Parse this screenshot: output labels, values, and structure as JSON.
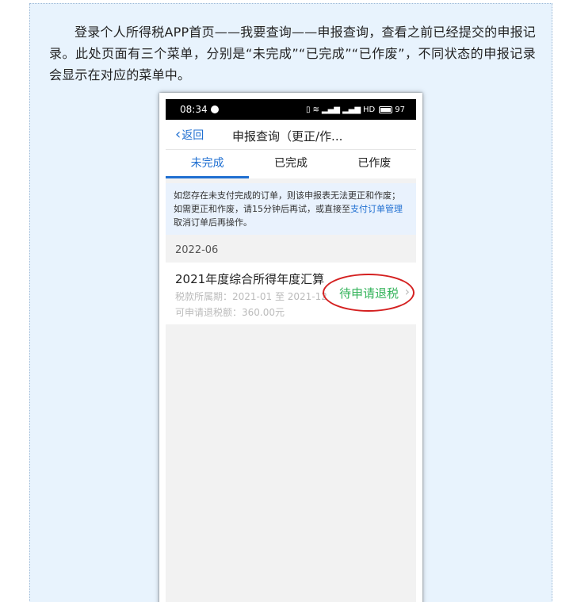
{
  "article": {
    "paragraph": "登录个人所得税APP首页——我要查询——申报查询，查看之前已经提交的申报记录。此处页面有三个菜单，分别是“未完成”“已完成”“已作废”，不同状态的申报记录会显示在对应的菜单中。"
  },
  "status_bar": {
    "time": "08:34",
    "signal_text": "HD",
    "battery": "97"
  },
  "nav": {
    "back_label": "返回",
    "title": "申报查询（更正/作..."
  },
  "tabs": [
    {
      "label": "未完成",
      "active": true
    },
    {
      "label": "已完成",
      "active": false
    },
    {
      "label": "已作废",
      "active": false
    }
  ],
  "notice": {
    "text_before": "如您存在未支付完成的订单，则该申报表无法更正和作废；如需更正和作废，请15分钟后再试，或直接至",
    "link": "支付订单管理",
    "text_after": "取消订单后再操作。"
  },
  "period": "2022-06",
  "record": {
    "title": "2021年度综合所得年度汇算",
    "tax_period": "税款所属期：2021-01 至 2021-12",
    "refund_amount": "可申请退税额：360.00元",
    "status": "待申请退税"
  },
  "colors": {
    "accent": "#1f6fd1",
    "status_green": "#33b35a",
    "annotation_red": "#d42020",
    "background": "#e8f3fd"
  }
}
